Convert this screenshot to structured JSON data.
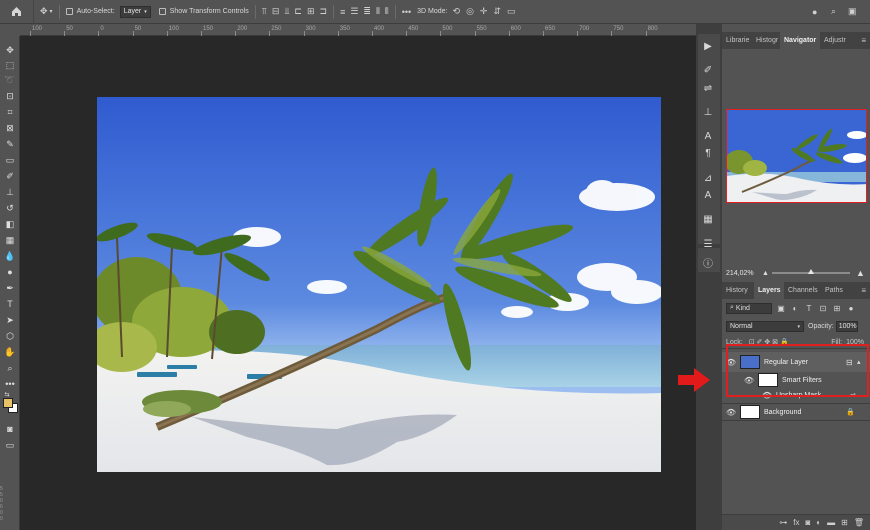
{
  "options_bar": {
    "auto_select_label": "Auto-Select:",
    "auto_select_value": "Layer",
    "transform_label": "Show Transform Controls",
    "mode_3d_label": "3D Mode:"
  },
  "ruler": {
    "ticks": [
      "100",
      "50",
      "0",
      "50",
      "100",
      "150",
      "200",
      "250",
      "300",
      "350",
      "400",
      "450",
      "500",
      "550",
      "600",
      "650",
      "700",
      "750",
      "800"
    ],
    "left_ticks": [
      "5",
      "5",
      "0",
      "6",
      "0",
      "0"
    ]
  },
  "panels": {
    "top_tabs": [
      "Librarie",
      "Histogr",
      "Navigator",
      "Adjustr"
    ],
    "active_top_tab": "Navigator",
    "zoom": "214,02%",
    "layer_tabs": [
      "History",
      "Layers",
      "Channels",
      "Paths"
    ],
    "kind_label": "Kind",
    "blend_mode": "Normal",
    "opacity_label": "Opacity:",
    "opacity_value": "100%",
    "lock_label": "Lock:",
    "fill_label": "Fill:",
    "fill_value": "100%"
  },
  "layers": [
    {
      "name": "Regular Layer"
    },
    {
      "name": "Smart Filters"
    },
    {
      "name": "Unsharp Mask"
    },
    {
      "name": "Background"
    }
  ],
  "colors": {
    "foreground": "#e8c36a",
    "background": "#ffffff",
    "highlight": "#e02020",
    "arrow": "#e31a1a"
  },
  "icons": [
    "home-icon",
    "move-icon",
    "align-icon",
    "more-icon",
    "3d-orbit-icon",
    "search-icon",
    "workspace-icon",
    "eye-icon",
    "lock-icon",
    "fx-icon",
    "trash-icon"
  ]
}
